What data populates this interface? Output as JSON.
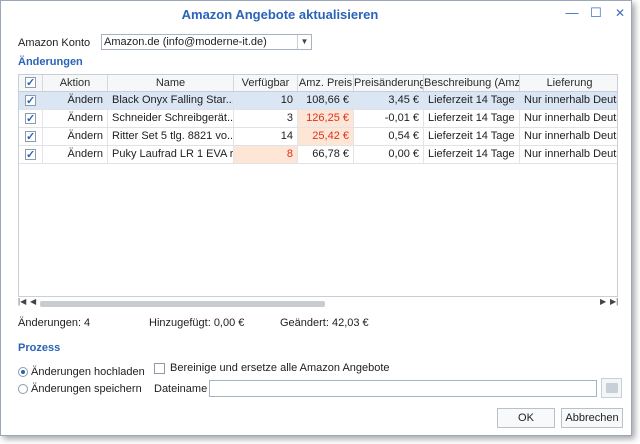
{
  "window": {
    "title": "Amazon Angebote aktualisieren"
  },
  "account": {
    "label": "Amazon Konto",
    "value": "Amazon.de (info@moderne-it.de)"
  },
  "changes_section": {
    "title": "Änderungen"
  },
  "grid": {
    "columns": [
      "Aktion",
      "Name",
      "Verfügbar",
      "Amz. Preis",
      "Preisänderung",
      "Beschreibung (Amz.)",
      "Lieferung"
    ],
    "rows": [
      {
        "checked": true,
        "aktion": "Ändern",
        "name": "Black Onyx Falling Star...",
        "verfuegbar": "10",
        "preis": "108,66 €",
        "preisaenderung": "3,45 €",
        "beschreibung": "Lieferzeit 14 Tage",
        "lieferung": "Nur innerhalb Deutschlan"
      },
      {
        "checked": true,
        "aktion": "Ändern",
        "name": "Schneider Schreibgerät...",
        "verfuegbar": "3",
        "preis": "126,25 €",
        "preisaenderung": "-0,01 €",
        "beschreibung": "Lieferzeit 14 Tage",
        "lieferung": "Nur innerhalb Deutschlan"
      },
      {
        "checked": true,
        "aktion": "Ändern",
        "name": "Ritter Set 5 tlg. 8821 vo...",
        "verfuegbar": "14",
        "preis": "25,42 €",
        "preisaenderung": "0,54 €",
        "beschreibung": "Lieferzeit 14 Tage",
        "lieferung": "Nur innerhalb Deutschlan"
      },
      {
        "checked": true,
        "aktion": "Ändern",
        "name": "Puky Laufrad LR 1 EVA r...",
        "verfuegbar": "8",
        "preis": "66,78 €",
        "preisaenderung": "0,00 €",
        "beschreibung": "Lieferzeit 14 Tage",
        "lieferung": "Nur innerhalb Deutschlan"
      }
    ]
  },
  "summary": {
    "changes": "Änderungen: 4",
    "added": "Hinzugefügt: 0,00 €",
    "changed": "Geändert: 42,03 €"
  },
  "process": {
    "title": "Prozess",
    "option_upload": "Änderungen hochladen",
    "option_save": "Änderungen speichern",
    "replace_label": "Bereinige und ersetze alle Amazon Angebote",
    "filename_label": "Dateiname",
    "filename_value": ""
  },
  "buttons": {
    "ok": "OK",
    "cancel": "Abbrechen"
  },
  "colors": {
    "accent": "#2a63b8",
    "selected_row": "#dbe6f4",
    "highlight_bg": "#fde6d6",
    "highlight_text": "#e0301e"
  }
}
